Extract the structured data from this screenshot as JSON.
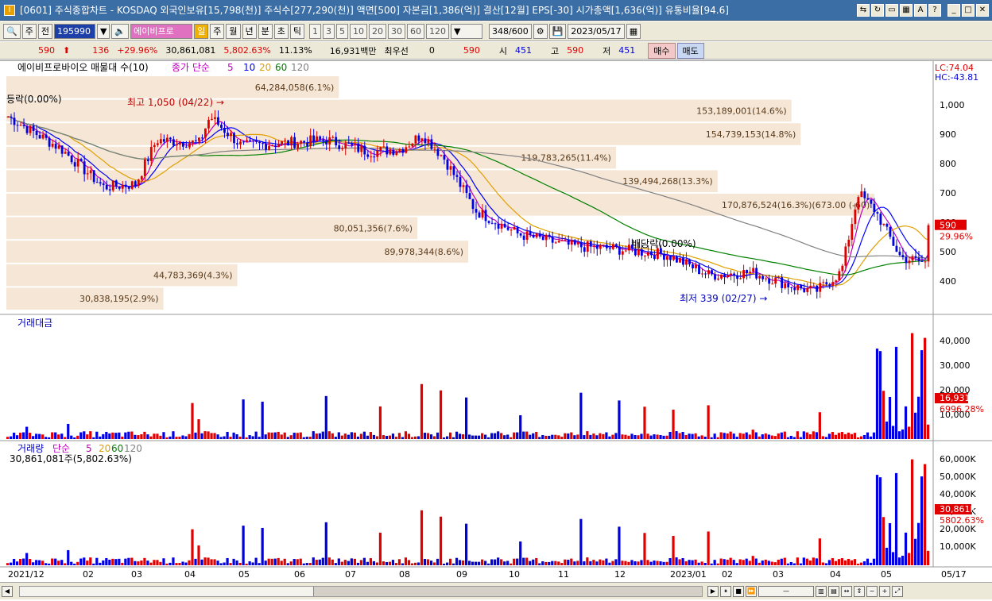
{
  "title": "[0601] 주식종합차트 - KOSDAQ 외국인보유[15,798(천)] 주식수[277,290(천)] 액면[500] 자본금[1,386(억)] 결산[12월] EPS[-30] 시가총액[1,636(억)] 유통비율[94.6]",
  "toolbar": {
    "period_type": "주",
    "prev_label": "전",
    "code": "195990",
    "name": "에이비프로",
    "tabs": [
      "일",
      "주",
      "월",
      "년",
      "분",
      "초",
      "틱"
    ],
    "active_tab": "일",
    "counts": [
      "1",
      "3",
      "5",
      "10",
      "20",
      "30",
      "60",
      "120"
    ],
    "range": "348",
    "range_total": "/600",
    "date": "2023/05/17"
  },
  "info": {
    "price": "590",
    "change": "136",
    "change_pct": "+29.96%",
    "volume": "30,861,081",
    "volume_pct": "5,802.63%",
    "turnover": "11.13%",
    "amount": "16,931백만",
    "best_label": "최우선",
    "best_value": "0",
    "best_price": "590",
    "open_label": "시",
    "open": "451",
    "high_label": "고",
    "high": "590",
    "low_label": "저",
    "low": "451",
    "buy": "매수",
    "sell": "매도"
  },
  "chart_data": {
    "type": "candlestick",
    "title": "에이비프로바이오 매물대 수(10)",
    "ma_legend": {
      "label": "종가 단순",
      "periods": [
        "5",
        "10",
        "20",
        "60",
        "120"
      ],
      "colors": [
        "#c000c0",
        "#0000ff",
        "#e0a000",
        "#008000",
        "#808080"
      ]
    },
    "lc": "LC:74.04",
    "hc": "HC:-43.81",
    "y_ticks": [
      1000,
      900,
      800,
      700,
      600,
      500,
      400
    ],
    "y_range": [
      300,
      1100
    ],
    "last_price": "590",
    "last_change": "29.96%",
    "high_note": "최고 1,050 (04/22)",
    "low_note": "최저 339 (02/27)",
    "label_left": "등락(0.00%)",
    "label_mid": "배당락(0.00%)",
    "volume_profile": [
      {
        "label": "30,838,195(2.9%)",
        "w": 0.17
      },
      {
        "label": "44,783,369(4.3%)",
        "w": 0.25
      },
      {
        "label": "89,978,344(8.6%)",
        "w": 0.5
      },
      {
        "label": "80,051,356(7.6%)",
        "w": 0.445
      },
      {
        "label": "170,876,524(16.3%)(673.00 (-60)",
        "w": 0.94
      },
      {
        "label": "139,494,268(13.3%)",
        "w": 0.77
      },
      {
        "label": "119,783,265(11.4%)",
        "w": 0.66
      },
      {
        "label": "154,739,153(14.8%)",
        "w": 0.86
      },
      {
        "label": "153,189,001(14.6%)",
        "w": 0.85
      },
      {
        "label": "64,284,058(6.1%)",
        "w": 0.36
      }
    ],
    "x_labels": [
      "2021/12",
      "02",
      "03",
      "04",
      "05",
      "06",
      "07",
      "08",
      "09",
      "10",
      "11",
      "12",
      "2023/01",
      "02",
      "03",
      "04",
      "05",
      "05/17"
    ],
    "amount_panel": {
      "title": "거래대금",
      "y_ticks": [
        "40,000",
        "30,000",
        "20,000",
        "10,000"
      ],
      "last": "16,931",
      "last_pct": "6996.28%"
    },
    "volume_panel": {
      "title": "거래량",
      "ma_label": "단순",
      "periods": [
        "5",
        "20",
        "60",
        "120"
      ],
      "value": "30,861,081주(5,802.63%)",
      "y_ticks": [
        "60,000K",
        "50,000K",
        "40,000K",
        "30,000K",
        "20,000K",
        "10,000K"
      ],
      "last": "30,861K",
      "last_pct": "5802.63%"
    }
  }
}
